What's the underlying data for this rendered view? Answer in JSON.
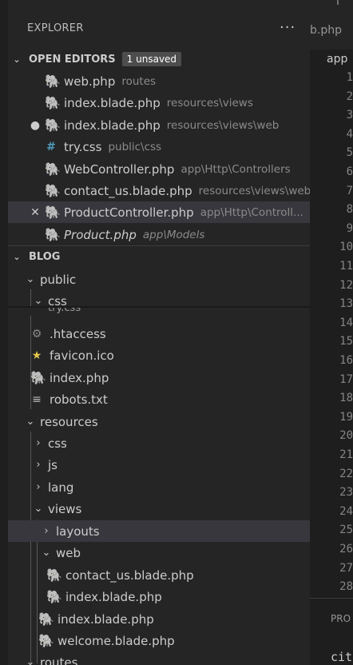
{
  "explorer": {
    "title": "EXPLORER",
    "more": "···"
  },
  "open_editors": {
    "header": "OPEN EDITORS",
    "badge": "1 unsaved",
    "items": [
      {
        "name": "web.php",
        "path": "routes",
        "icon": "php-icon"
      },
      {
        "name": "index.blade.php",
        "path": "resources\\views",
        "icon": "php-icon"
      },
      {
        "name": "index.blade.php",
        "path": "resources\\views\\web",
        "icon": "php-icon",
        "dirty": "●"
      },
      {
        "name": "try.css",
        "path": "public\\css",
        "icon": "css-icon",
        "glyph": "#"
      },
      {
        "name": "WebController.php",
        "path": "app\\Http\\Controllers",
        "icon": "php-icon"
      },
      {
        "name": "contact_us.blade.php",
        "path": "resources\\views\\web",
        "icon": "php-icon"
      },
      {
        "name": "ProductController.php",
        "path": "app\\Http\\Controll...",
        "icon": "php-icon",
        "close": "✕"
      },
      {
        "name": "Product.php",
        "path": "app\\Models",
        "icon": "php-icon"
      }
    ]
  },
  "blog": {
    "header": "BLOG",
    "items": [
      {
        "name": "public",
        "type": "folder"
      },
      {
        "name": "css",
        "type": "folder"
      },
      {
        "name": "try.css",
        "type": "file"
      },
      {
        "name": ".htaccess",
        "type": "file"
      },
      {
        "name": "favicon.ico",
        "type": "file"
      },
      {
        "name": "index.php",
        "type": "file"
      },
      {
        "name": "robots.txt",
        "type": "file"
      },
      {
        "name": "resources",
        "type": "folder"
      },
      {
        "name": "css",
        "type": "folder"
      },
      {
        "name": "js",
        "type": "folder"
      },
      {
        "name": "lang",
        "type": "folder"
      },
      {
        "name": "views",
        "type": "folder"
      },
      {
        "name": "layouts",
        "type": "folder"
      },
      {
        "name": "web",
        "type": "folder"
      },
      {
        "name": "contact_us.blade.php",
        "type": "file"
      },
      {
        "name": "index.blade.php",
        "type": "file"
      },
      {
        "name": "index.blade.php",
        "type": "file"
      },
      {
        "name": "welcome.blade.php",
        "type": "file"
      },
      {
        "name": "routes",
        "type": "folder"
      }
    ]
  },
  "editor": {
    "tab": "b.php",
    "breadcrumb": "app",
    "line_numbers": [
      "1",
      "2",
      "3",
      "4",
      "5",
      "6",
      "7",
      "8",
      "9",
      "10",
      "11",
      "12",
      "13",
      "14",
      "15",
      "16",
      "17",
      "18",
      "19",
      "20",
      "21",
      "22",
      "23",
      "24",
      "25",
      "26",
      "27",
      "28"
    ],
    "panel_tab": "PRO",
    "panel_text": "cit"
  },
  "colors": {
    "php": "#a074c4",
    "css": "#519aba",
    "star": "#e5c84a",
    "selected": "#37373d"
  }
}
